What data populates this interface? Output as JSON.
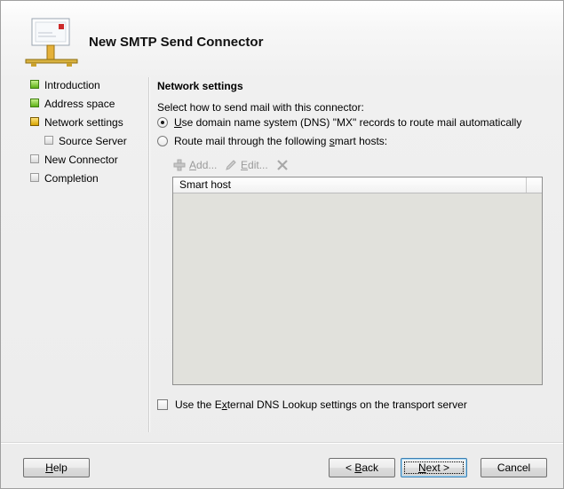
{
  "window": {
    "title": "New SMTP Send Connector"
  },
  "nav": {
    "items": [
      {
        "label": "Introduction",
        "status": "completed"
      },
      {
        "label": "Address space",
        "status": "completed"
      },
      {
        "label": "Network settings",
        "status": "current"
      },
      {
        "label": "Source Server",
        "status": "pending"
      },
      {
        "label": "New Connector",
        "status": "pending"
      },
      {
        "label": "Completion",
        "status": "pending"
      }
    ]
  },
  "content": {
    "section_title": "Network settings",
    "instruction": "Select how to send mail with this connector:",
    "option_dns": {
      "pre": "",
      "accel": "U",
      "post": "se domain name system (DNS) \"MX\" records to route mail automatically",
      "checked": true
    },
    "option_smarthost": {
      "pre": "Route mail through the following ",
      "accel": "s",
      "post": "mart hosts:",
      "checked": false
    },
    "toolbar": {
      "add": {
        "pre": "",
        "accel": "A",
        "post": "dd..."
      },
      "edit": {
        "pre": "",
        "accel": "E",
        "post": "dit..."
      },
      "delete_icon": "delete-x-icon"
    },
    "smart_host_list": {
      "columns": [
        "Smart host"
      ],
      "rows": []
    },
    "external_dns": {
      "pre": "Use the E",
      "accel": "x",
      "post": "ternal DNS Lookup settings on the transport server",
      "checked": false
    }
  },
  "buttons": {
    "help": {
      "pre": "",
      "accel": "H",
      "post": "elp"
    },
    "back": {
      "pre": "< ",
      "accel": "B",
      "post": "ack"
    },
    "next": {
      "pre": "",
      "accel": "N",
      "post": "ext >"
    },
    "cancel": {
      "label": "Cancel"
    }
  },
  "colors": {
    "completed": "#5fb117",
    "current": "#d7a300",
    "pending": "#d9d9d9",
    "list_background": "#e1e1dc",
    "default_button_border": "#3c7fb1"
  }
}
